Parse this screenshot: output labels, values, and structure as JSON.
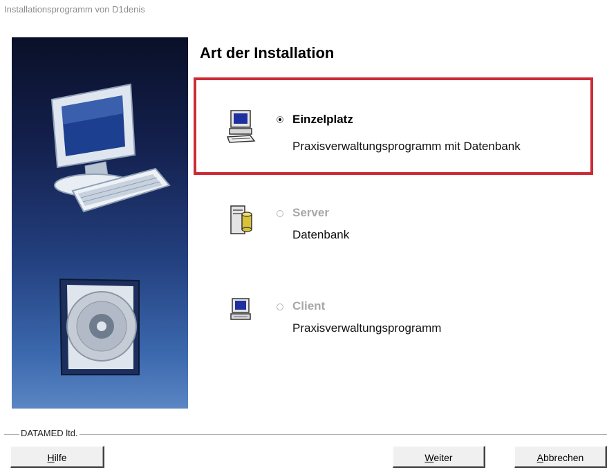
{
  "window": {
    "title": "Installationsprogramm von D1denis"
  },
  "heading": "Art der Installation",
  "options": [
    {
      "label": "Einzelplatz",
      "description": "Praxisverwaltungsprogramm mit Datenbank",
      "selected": true,
      "enabled": true,
      "icon": "desktop-computer-icon"
    },
    {
      "label": "Server",
      "description": "Datenbank",
      "selected": false,
      "enabled": false,
      "icon": "server-database-icon"
    },
    {
      "label": "Client",
      "description": "Praxisverwaltungsprogramm",
      "selected": false,
      "enabled": false,
      "icon": "client-computer-icon"
    }
  ],
  "group_label": "DATAMED ltd.",
  "buttons": {
    "help": {
      "accel": "H",
      "rest": "ilfe"
    },
    "next": {
      "accel": "W",
      "rest": "eiter"
    },
    "cancel": {
      "accel": "A",
      "rest": "bbrechen"
    }
  },
  "colors": {
    "highlight": "#cc2a36",
    "panel_top": "#0a1028",
    "panel_bottom": "#5a86c4"
  }
}
